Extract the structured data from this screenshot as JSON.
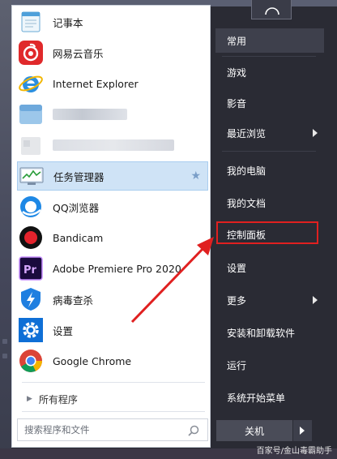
{
  "programs": [
    {
      "label": "记事本",
      "icon": "notepad-icon"
    },
    {
      "label": "网易云音乐",
      "icon": "netease-music-icon"
    },
    {
      "label": "Internet Explorer",
      "icon": "ie-icon"
    },
    {
      "label": "",
      "icon": "blurred-app-icon"
    },
    {
      "label": "",
      "icon": "blurred-app-icon"
    },
    {
      "label": "任务管理器",
      "icon": "task-manager-icon",
      "selected": true
    },
    {
      "label": "QQ浏览器",
      "icon": "qq-browser-icon"
    },
    {
      "label": "Bandicam",
      "icon": "bandicam-icon"
    },
    {
      "label": "Adobe Premiere Pro 2020",
      "icon": "premiere-icon"
    },
    {
      "label": "病毒查杀",
      "icon": "antivirus-icon"
    },
    {
      "label": "设置",
      "icon": "settings-gear-icon"
    },
    {
      "label": "Google Chrome",
      "icon": "chrome-icon"
    }
  ],
  "all_programs": "所有程序",
  "search": {
    "placeholder": "搜索程序和文件"
  },
  "right_menu": [
    {
      "label": "常用"
    },
    {
      "label": "游戏"
    },
    {
      "label": "影音"
    },
    {
      "label": "最近浏览"
    },
    {
      "label": "我的电脑"
    },
    {
      "label": "我的文档"
    },
    {
      "label": "控制面板"
    },
    {
      "label": "设置"
    },
    {
      "label": "更多"
    },
    {
      "label": "安装和卸载软件"
    },
    {
      "label": "运行"
    },
    {
      "label": "系统开始菜单"
    }
  ],
  "shutdown_label": "关机",
  "watermark": "百家号/金山毒霸助手",
  "colors": {
    "highlight_box": "#e02020",
    "arrow": "#e02020",
    "selected_row": "#cfe3f6"
  }
}
